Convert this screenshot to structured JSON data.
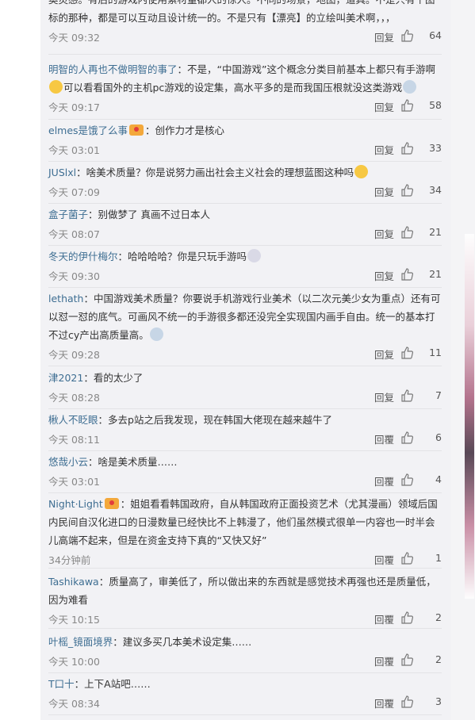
{
  "comments": [
    {
      "author": "",
      "text": "奥灵感。有后的游戏内使用素材量都人的惊人。不同的场景，地图，道具。不是只有个图标的那种，都是可以互动且设计统一的。不是只有【漂亮】的立绘叫美术啊，，，",
      "time": "今天 09:32",
      "reply": "回复",
      "likes": "64"
    },
    {
      "author": "明智的人再也不做明智的事了",
      "text": "：不是，“中国游戏”这个概念分类目前基本上都只有手游啊",
      "text2": "可以看看国外的主机pc游戏的设定集，高水平多的是而我国压根就没这类游戏",
      "time": "今天 09:17",
      "reply": "回复",
      "likes": "58"
    },
    {
      "author": "elmes是饿了么事",
      "text": "：创作力才是核心",
      "time": "今天 03:01",
      "reply": "回复",
      "likes": "33"
    },
    {
      "author": "JUSlxl",
      "text": "：啥美术质量？你是说努力画出社会主义社会的理想蓝图这种吗",
      "time": "今天 07:09",
      "reply": "回复",
      "likes": "34"
    },
    {
      "author": "盒子菌子",
      "text": "：别做梦了 真画不过日本人",
      "time": "今天 08:07",
      "reply": "回复",
      "likes": "21"
    },
    {
      "author": "冬天的伊什梅尔",
      "text": "：哈哈哈哈？你是只玩手游吗",
      "time": "今天 09:30",
      "reply": "回复",
      "likes": "21"
    },
    {
      "author": "lethath",
      "text": "：中国游戏美术质量？你要说手机游戏行业美术（以二次元美少女为重点）还有可以怼一怼的底气。可画风不统一的手游很多都还没完全实现国内画手自由。统一的基本打不过cy产出高质量高。",
      "time": "今天 09:28",
      "reply": "回复",
      "likes": "11"
    },
    {
      "author": "津2021",
      "text": "：看的太少了",
      "time": "今天 08:28",
      "reply": "回复",
      "likes": "7"
    },
    {
      "author": "楸人不眨眼",
      "text": "：多去p站之后我发现，现在韩国大佬现在越来越牛了",
      "time": "今天 08:11",
      "reply": "回覆",
      "likes": "6"
    },
    {
      "author": "悠哉小云",
      "text": "：啥是美术质量……",
      "time": "今天 03:01",
      "reply": "回覆",
      "likes": "4"
    },
    {
      "author": "Night·Light",
      "text": "：姐姐看看韩国政府，自从韩国政府正面投资艺术（尤其漫画）领域后国内民间自汉化进口的日漫数量已经快比不上韩漫了，他们虽然模式很单一内容也一时半会儿高端不起来，但是在资金支持下真的“又快又好”",
      "time": "34分钟前",
      "reply": "回覆",
      "likes": "1"
    },
    {
      "author": "Tashikawa",
      "text": "：质量高了，审美低了，所以做出来的东西就是感觉技术再强也还是质量低，因为难看",
      "time": "今天 10:15",
      "reply": "回覆",
      "likes": "2"
    },
    {
      "author": "叶榣_镜面境界",
      "text": "：建议多买几本美术设定集……",
      "time": "今天 10:00",
      "reply": "回覆",
      "likes": "2"
    },
    {
      "author": "T口十",
      "text": "：上下A站吧……",
      "time": "今天 08:34",
      "reply": "回覆",
      "likes": "3"
    }
  ]
}
